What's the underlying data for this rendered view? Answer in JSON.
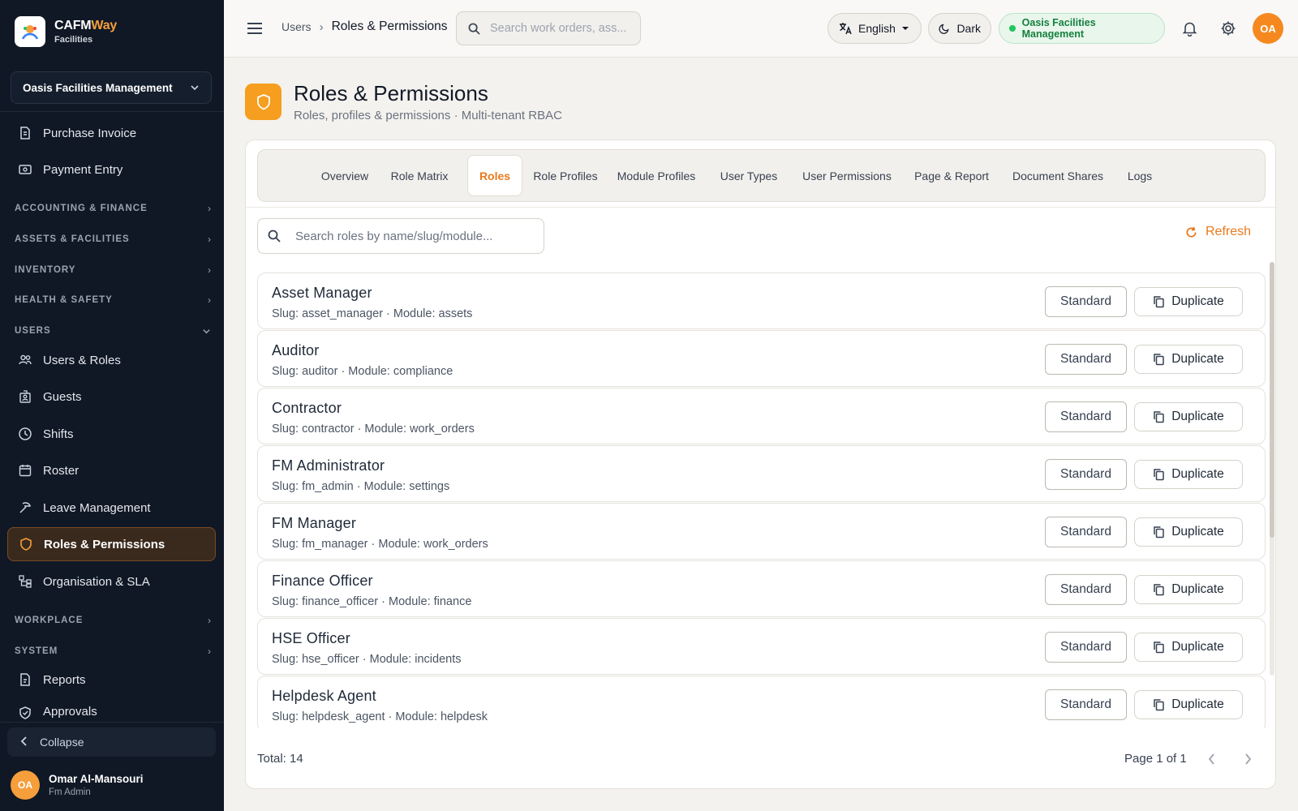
{
  "brand": {
    "name": "CAFM",
    "name_accent": "Way",
    "sub": "Facilities"
  },
  "org_select": {
    "value": "Oasis Facilities Management"
  },
  "sidebar": {
    "top_items": [
      {
        "label": "Purchase Invoice",
        "icon": "invoice-icon"
      },
      {
        "label": "Payment Entry",
        "icon": "payment-icon"
      }
    ],
    "sections": [
      {
        "label": "ACCOUNTING & FINANCE",
        "expanded": false
      },
      {
        "label": "ASSETS & FACILITIES",
        "expanded": false
      },
      {
        "label": "INVENTORY",
        "expanded": false
      },
      {
        "label": "HEALTH & SAFETY",
        "expanded": false
      },
      {
        "label": "USERS",
        "expanded": true
      },
      {
        "label": "WORKPLACE",
        "expanded": false
      },
      {
        "label": "SYSTEM",
        "expanded": false
      }
    ],
    "users_items": [
      {
        "label": "Users & Roles",
        "icon": "users-icon"
      },
      {
        "label": "Guests",
        "icon": "guests-icon"
      },
      {
        "label": "Shifts",
        "icon": "clock-icon"
      },
      {
        "label": "Roster",
        "icon": "calendar-icon"
      },
      {
        "label": "Leave Management",
        "icon": "leave-icon"
      },
      {
        "label": "Roles & Permissions",
        "icon": "shield-icon",
        "active": true
      },
      {
        "label": "Organisation & SLA",
        "icon": "org-chart-icon"
      }
    ],
    "system_items": [
      {
        "label": "Reports",
        "icon": "report-icon"
      },
      {
        "label": "Approvals",
        "icon": "approval-icon"
      }
    ],
    "collapse_label": "Collapse",
    "user": {
      "initials": "OA",
      "name": "Omar Al-Mansouri",
      "role": "Fm Admin"
    }
  },
  "topbar": {
    "breadcrumb": [
      "Users",
      "Roles & Permissions"
    ],
    "search_placeholder": "Search work orders, ass...",
    "language": "English",
    "theme": "Dark",
    "org_badge": "Oasis Facilities Management",
    "avatar_initials": "OA"
  },
  "page": {
    "title": "Roles & Permissions",
    "subtitle": "Roles, profiles & permissions · Multi-tenant RBAC"
  },
  "tabs": [
    {
      "label": "Overview"
    },
    {
      "label": "Role Matrix"
    },
    {
      "label": "Roles",
      "active": true
    },
    {
      "label": "Role Profiles"
    },
    {
      "label": "Module Profiles"
    },
    {
      "label": "User Types"
    },
    {
      "label": "User Permissions"
    },
    {
      "label": "Page & Report"
    },
    {
      "label": "Document Shares"
    },
    {
      "label": "Logs"
    }
  ],
  "roles_search_placeholder": "Search roles by name/slug/module...",
  "refresh_label": "Refresh",
  "roles": [
    {
      "name": "Asset Manager",
      "meta": "Slug: asset_manager · Module: assets",
      "type": "Standard",
      "action": "Duplicate"
    },
    {
      "name": "Auditor",
      "meta": "Slug: auditor · Module: compliance",
      "type": "Standard",
      "action": "Duplicate"
    },
    {
      "name": "Contractor",
      "meta": "Slug: contractor · Module: work_orders",
      "type": "Standard",
      "action": "Duplicate"
    },
    {
      "name": "FM Administrator",
      "meta": "Slug: fm_admin · Module: settings",
      "type": "Standard",
      "action": "Duplicate"
    },
    {
      "name": "FM Manager",
      "meta": "Slug: fm_manager · Module: work_orders",
      "type": "Standard",
      "action": "Duplicate"
    },
    {
      "name": "Finance Officer",
      "meta": "Slug: finance_officer · Module: finance",
      "type": "Standard",
      "action": "Duplicate"
    },
    {
      "name": "HSE Officer",
      "meta": "Slug: hse_officer · Module: incidents",
      "type": "Standard",
      "action": "Duplicate"
    },
    {
      "name": "Helpdesk Agent",
      "meta": "Slug: helpdesk_agent · Module: helpdesk",
      "type": "Standard",
      "action": "Duplicate"
    }
  ],
  "footer": {
    "total": "Total: 14",
    "page": "Page 1 of 1"
  },
  "colors": {
    "accent": "#ea7a1c",
    "sidebar_bg": "#101826",
    "badge_green": "#15803d"
  }
}
